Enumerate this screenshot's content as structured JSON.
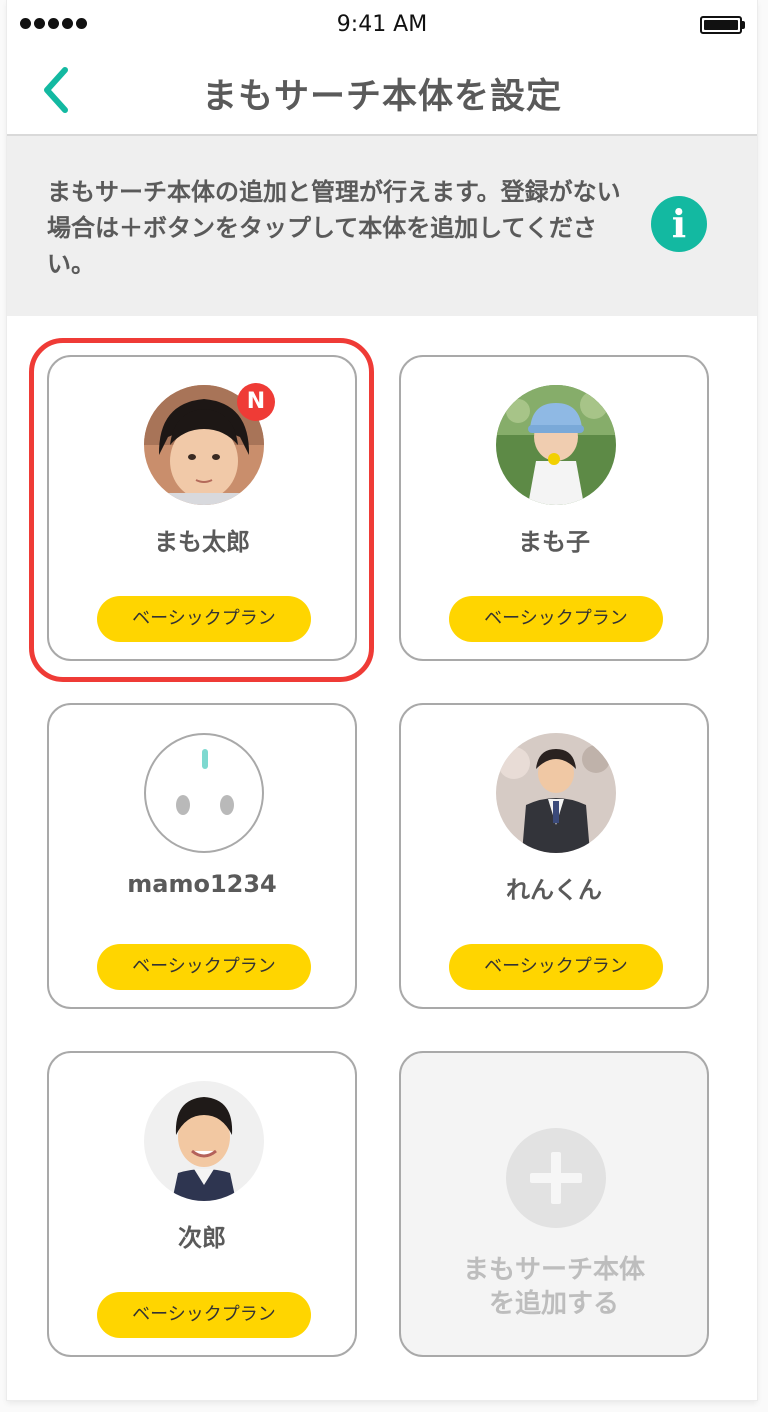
{
  "status_bar": {
    "time": "9:41 AM"
  },
  "header": {
    "title": "まもサーチ本体を設定"
  },
  "info": {
    "text": "まもサーチ本体の追加と管理が行えます。登録がない場合は＋ボタンをタップして本体を追加してください。",
    "icon": "info-icon"
  },
  "devices": [
    {
      "name": "まも太郎",
      "plan": "ベーシックプラン",
      "badge": "N",
      "avatar": "child-photo-boy",
      "selected": true
    },
    {
      "name": "まも子",
      "plan": "ベーシックプラン",
      "avatar": "child-photo-girl"
    },
    {
      "name": "mamo1234",
      "plan": "ベーシックプラン",
      "avatar": "device-icon"
    },
    {
      "name": "れんくん",
      "plan": "ベーシックプラン",
      "avatar": "child-photo-boy-uniform"
    },
    {
      "name": "次郎",
      "plan": "ベーシックプラン",
      "avatar": "child-photo-boy-smiling"
    }
  ],
  "add_device": {
    "label": "まもサーチ本体\nを追加する",
    "icon": "plus-icon"
  },
  "colors": {
    "accent": "#13b9a1",
    "plan_badge": "#ffd500",
    "highlight": "#ef3b36"
  }
}
